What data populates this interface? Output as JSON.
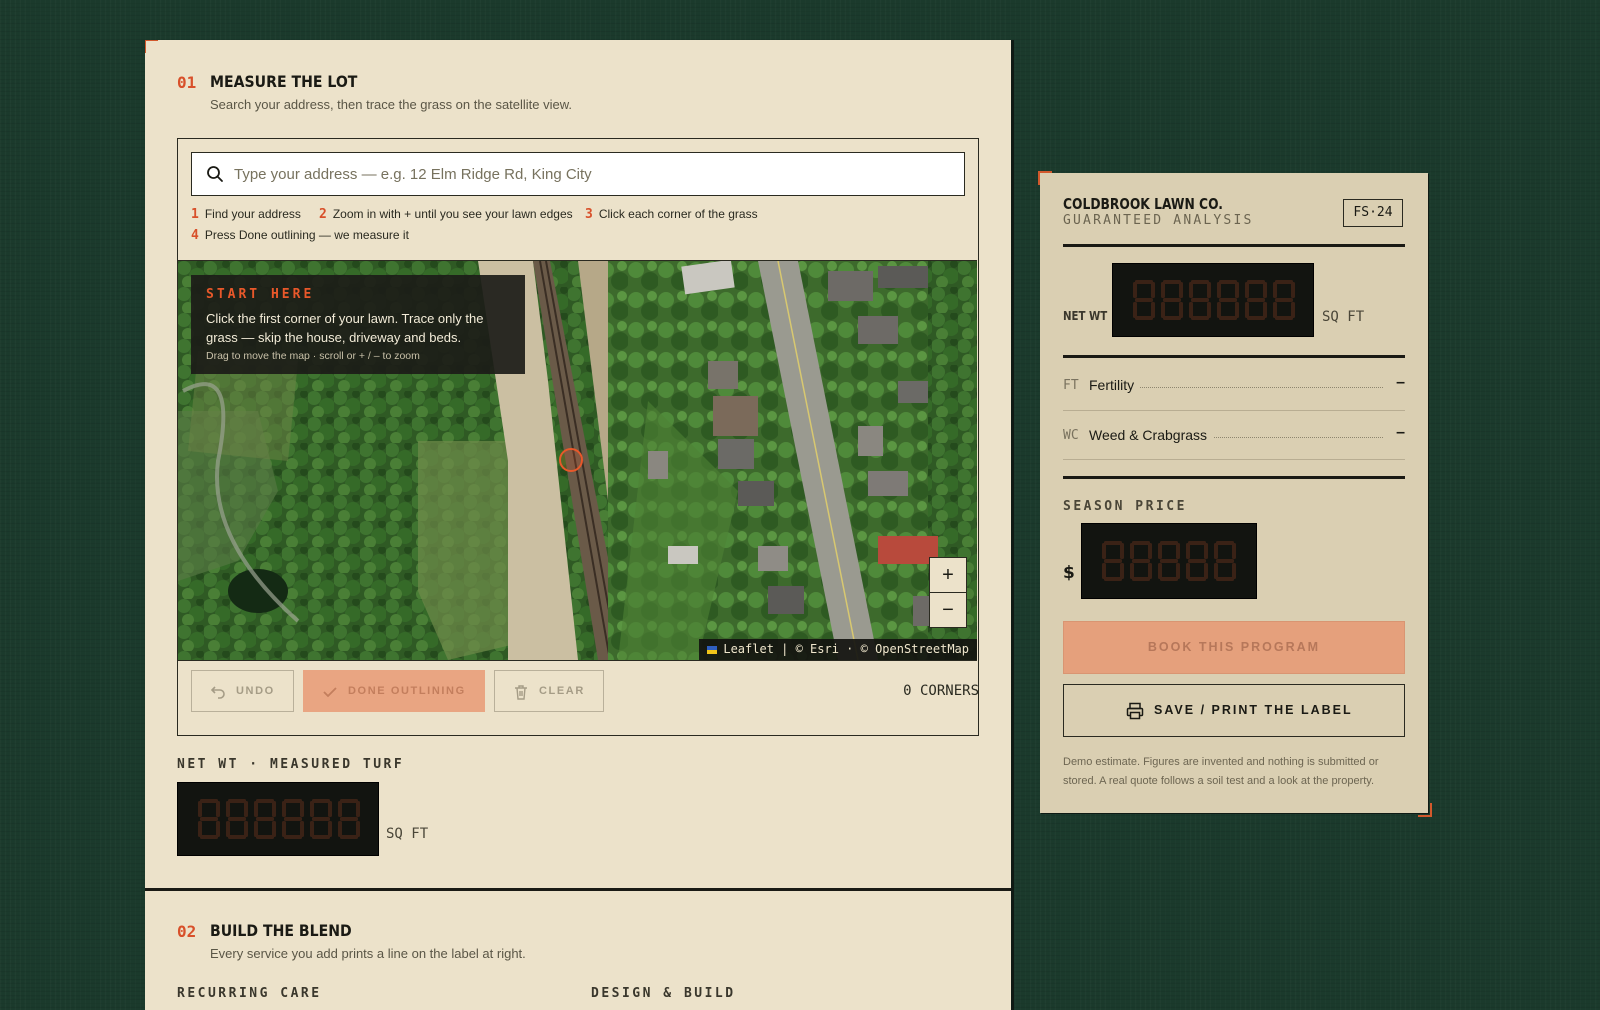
{
  "section1": {
    "number": "01",
    "title": "MEASURE THE LOT",
    "subtitle": "Search your address, then trace the grass on the satellite view."
  },
  "search": {
    "placeholder": "Type your address — e.g. 12 Elm Ridge Rd, King City",
    "value": ""
  },
  "steps": [
    {
      "num": "1",
      "text": "Find your address"
    },
    {
      "num": "2",
      "text": "Zoom in with + until you see your lawn edges"
    },
    {
      "num": "3",
      "text": "Click each corner of the grass"
    },
    {
      "num": "4",
      "text": "Press Done outlining — we measure it"
    }
  ],
  "map": {
    "overlay_kicker": "START HERE",
    "overlay_body": "Click the first corner of your lawn. Trace only the grass — skip the house, driveway and beds.",
    "overlay_hint": "Drag to move the map · scroll or + / – to zoom",
    "zoom_in": "+",
    "zoom_out": "−",
    "attribution": "Leaflet | © Esri · © OpenStreetMap"
  },
  "controls": {
    "undo": "UNDO",
    "done": "DONE OUTLINING",
    "clear": "CLEAR",
    "corners": "0 CORNERS"
  },
  "measured": {
    "label": "NET WT · MEASURED TURF",
    "display": "888888",
    "unit": "SQ FT"
  },
  "section2": {
    "number": "02",
    "title": "BUILD THE BLEND",
    "subtitle": "Every service you add prints a line on the label at right.",
    "col1": "RECURRING CARE",
    "col2": "DESIGN & BUILD"
  },
  "label_card": {
    "brand": "COLDBROOK LAWN CO.",
    "subtitle": "GUARANTEED ANALYSIS",
    "badge": "FS·24",
    "net_wt_label": "NET WT",
    "net_wt_display": "888888",
    "net_wt_unit": "SQ FT",
    "lines": [
      {
        "code": "FT",
        "name": "Fertility",
        "value": "–"
      },
      {
        "code": "WC",
        "name": "Weed & Crabgrass",
        "value": "–"
      }
    ],
    "price_label": "SEASON PRICE",
    "currency": "$",
    "price_display": "88888",
    "book_button": "BOOK THIS PROGRAM",
    "print_button": "SAVE / PRINT THE LABEL",
    "disclaimer": "Demo estimate. Figures are invented and nothing is submitted or stored. A real quote follows a soil test and a look at the property."
  },
  "colors": {
    "accent": "#d8502a",
    "background": "#1b3a2c",
    "paper": "#ece2ca",
    "card": "#dacfb2",
    "lcd_bg": "#121410",
    "lcd_segment": "#3a2216"
  },
  "icons": [
    "search-icon",
    "undo-icon",
    "check-icon",
    "trash-icon",
    "printer-icon",
    "map-marker-icon"
  ]
}
